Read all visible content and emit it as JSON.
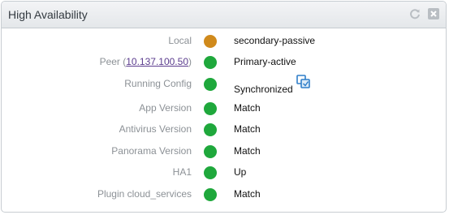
{
  "widget": {
    "title": "High Availability",
    "header_icons": [
      "refresh-icon",
      "close-icon"
    ]
  },
  "rows": [
    {
      "label": "Local",
      "status_color": "#d08a1c",
      "value": "secondary-passive"
    },
    {
      "label_prefix": "Peer (",
      "label_link": "10.137.100.50",
      "label_suffix": ")",
      "status_color": "#1fa83c",
      "value": "Primary-active"
    },
    {
      "label": "Running Config",
      "status_color": "#1fa83c",
      "value": "Synchronized",
      "value_icon": "sync-config-icon"
    },
    {
      "label": "App Version",
      "status_color": "#1fa83c",
      "value": "Match"
    },
    {
      "label": "Antivirus Version",
      "status_color": "#1fa83c",
      "value": "Match"
    },
    {
      "label": "Panorama Version",
      "status_color": "#1fa83c",
      "value": "Match"
    },
    {
      "label": "HA1",
      "status_color": "#1fa83c",
      "value": "Up"
    },
    {
      "label": "Plugin cloud_services",
      "status_color": "#1fa83c",
      "value": "Match"
    }
  ]
}
